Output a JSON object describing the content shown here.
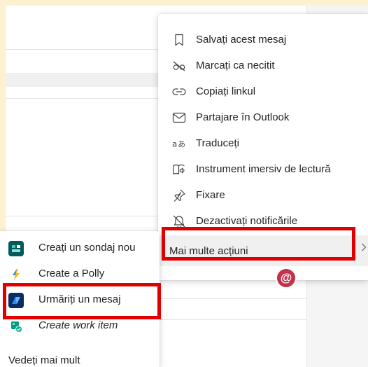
{
  "context_menu": {
    "items": [
      {
        "label": "Salvați acest mesaj",
        "icon": "bookmark-icon"
      },
      {
        "label": "Marcați ca necitit",
        "icon": "eye-off-icon"
      },
      {
        "label": "Copiați linkul",
        "icon": "link-icon"
      },
      {
        "label": "Partajare în Outlook",
        "icon": "mail-icon"
      },
      {
        "label": "Traduceți",
        "icon": "translate-icon"
      },
      {
        "label": "Instrument imersiv de lectură",
        "icon": "immersive-reader-icon"
      },
      {
        "label": "Fixare",
        "icon": "pin-icon"
      },
      {
        "label": "Dezactivați notificările",
        "icon": "bell-off-icon"
      }
    ],
    "more_actions_label": "Mai multe acțiuni"
  },
  "submenu": {
    "items": [
      {
        "label": "Creați un sondaj nou",
        "icon": "forms-poll-icon",
        "color": "#035a5a"
      },
      {
        "label": "Create a Polly",
        "icon": "polly-icon",
        "color": "#ffffff"
      },
      {
        "label": "Urmăriți un mesaj",
        "icon": "power-automate-icon",
        "color": "#0b2b63"
      },
      {
        "label": "Create work item",
        "icon": "azure-boards-icon",
        "color": "#ffffff"
      }
    ],
    "see_more_label": "Vedeți mai mult"
  },
  "mention_badge": "@",
  "colors": {
    "highlight": "#e00000",
    "badge": "#c4314b",
    "hover_background": "#f0f0f0"
  }
}
